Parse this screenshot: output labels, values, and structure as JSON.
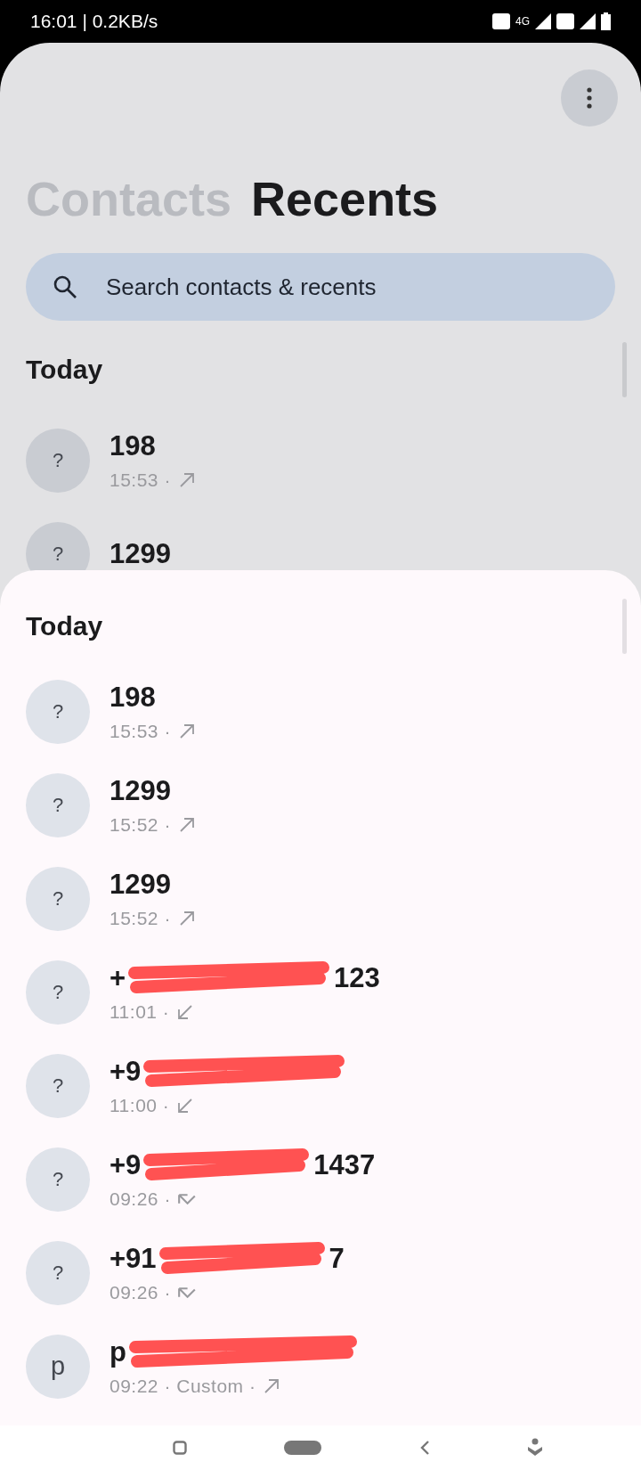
{
  "status_bar": {
    "time": "16:01 | 0.2KB/s",
    "network": "4G"
  },
  "background": {
    "tabs": [
      {
        "label": "Contacts",
        "selected": false
      },
      {
        "label": "Recents",
        "selected": true
      }
    ],
    "search": {
      "placeholder": "Search contacts & recents"
    },
    "section": "Today",
    "calls": [
      {
        "avatar": "?",
        "name": "198",
        "time": "15:53 ·",
        "kind": "outgoing"
      },
      {
        "avatar": "?",
        "name": "1299"
      }
    ]
  },
  "sheet": {
    "section": "Today",
    "calls": [
      {
        "avatar": "?",
        "name": "198",
        "time": "15:53 ·",
        "kind": "outgoing",
        "redacted": false
      },
      {
        "avatar": "?",
        "name": "1299",
        "time": "15:52 ·",
        "kind": "outgoing",
        "redacted": false
      },
      {
        "avatar": "?",
        "name": "1299",
        "time": "15:52 ·",
        "kind": "outgoing",
        "redacted": false
      },
      {
        "avatar": "?",
        "name": "+",
        "name_end": "123",
        "time": "11:01 ·",
        "kind": "incoming",
        "redacted": true
      },
      {
        "avatar": "?",
        "name": "+9",
        "time": "11:00 ·",
        "kind": "incoming",
        "redacted": true
      },
      {
        "avatar": "?",
        "name": "+9",
        "name_end": "1437",
        "time": "09:26 ·",
        "kind": "missed",
        "redacted": true
      },
      {
        "avatar": "?",
        "name": "+91",
        "name_end": "7",
        "time": "09:26 ·",
        "kind": "missed",
        "redacted": true
      },
      {
        "avatar": "p",
        "name": "p",
        "time": "09:22 · Custom ·",
        "kind": "outgoing",
        "redacted": true
      }
    ]
  }
}
